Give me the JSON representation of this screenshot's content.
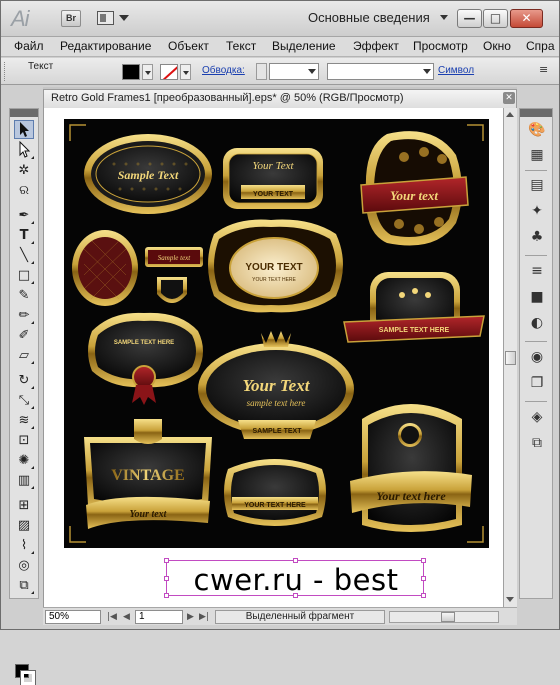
{
  "app": {
    "logo": "Ai",
    "bridge_label": "Br",
    "workspace": "Основные сведения",
    "window_buttons": {
      "minimize": "—",
      "maximize": "□",
      "close": "✕"
    }
  },
  "menu": [
    "Файл",
    "Редактирование",
    "Объект",
    "Текст",
    "Выделение",
    "Эффект",
    "Просмотр",
    "Окно",
    "Спра"
  ],
  "control_bar": {
    "object_type": "Текст",
    "fill_color": "#000000",
    "stroke_link": "Обводка:",
    "stroke_weight": "",
    "char_style": "",
    "symbol_link": "Символ"
  },
  "document": {
    "tab_title": "Retro Gold Frames1 [преобразованный].eps* @ 50% (RGB/Просмотр)",
    "close_glyph": "✕"
  },
  "artwork": {
    "labels": [
      "Sample Text",
      "Your Text",
      "YOUR TEXT",
      "Your text",
      "Sample text",
      "YOUR TEXT",
      "YOUR TEXT HERE",
      "SAMPLE TEXT HERE",
      "SAMPLE TEXT HERE",
      "Your Text",
      "sample text here",
      "SAMPLE TEXT",
      "VINTAGE",
      "Your text",
      "YOUR TEXT HERE",
      "Your text here"
    ]
  },
  "selected_text": "cwer.ru - best",
  "status": {
    "zoom": "50%",
    "page": "1",
    "mode": "Выделенный фрагмент"
  },
  "colors": {
    "gold": "#c9a23a",
    "gold_light": "#f3d77a",
    "frame_dark": "#0a0a0a",
    "ribbon_red": "#7a1214",
    "selection": "#c24bc2"
  },
  "tools": [
    "selection-tool",
    "direct-selection-tool",
    "magic-wand-tool",
    "lasso-tool",
    "pen-tool",
    "type-tool",
    "line-tool",
    "rectangle-tool",
    "paintbrush-tool",
    "pencil-tool",
    "blob-brush-tool",
    "eraser-tool",
    "rotate-tool",
    "scale-tool",
    "warp-tool",
    "free-transform-tool",
    "symbol-sprayer-tool",
    "column-graph-tool",
    "mesh-tool",
    "gradient-tool",
    "eyedropper-tool",
    "blend-tool",
    "artboard-tool",
    "slice-tool",
    "hand-tool",
    "zoom-tool"
  ],
  "panels": [
    "color-panel",
    "color-guide-panel",
    "swatches-panel",
    "brushes-panel",
    "symbols-panel",
    "stroke-panel",
    "gradient-panel",
    "transparency-panel",
    "appearance-panel",
    "graphic-styles-panel",
    "layers-panel",
    "artboards-panel"
  ]
}
